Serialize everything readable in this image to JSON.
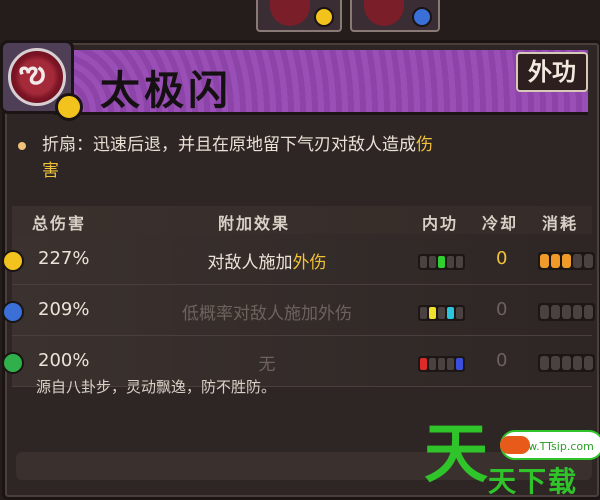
{
  "skill": {
    "name": "太极闪",
    "type_badge": "外功",
    "description_pre": "折扇：迅速后退，并且在原地留下气刃对敌人造成",
    "description_hl1": "伤",
    "description_hl2": "害"
  },
  "table": {
    "headers": {
      "total_damage": "总伤害",
      "effect": "附加效果",
      "internal": "内功",
      "cooldown": "冷却",
      "cost": "消耗"
    },
    "rows": [
      {
        "dot_color": "#f2c31c",
        "damage": "227%",
        "effect_pre": "对敌人施加",
        "effect_hl": "外伤",
        "effect_dim": false,
        "internal_pips": [
          "#4a4240",
          "#4a4240",
          "#2fd030",
          "#4a4240",
          "#4a4240"
        ],
        "cooldown": "0",
        "cooldown_dim": false,
        "cost_pips": [
          "#f09a2a",
          "#f09a2a",
          "#f09a2a",
          "#4a4240",
          "#4a4240"
        ]
      },
      {
        "dot_color": "#3a6fd8",
        "damage": "209%",
        "effect_pre": "低概率对敌人施加外伤",
        "effect_hl": "",
        "effect_dim": true,
        "internal_pips": [
          "#4a4240",
          "#f2e12a",
          "#4a4240",
          "#2ac6e0",
          "#4a4240"
        ],
        "cooldown": "0",
        "cooldown_dim": true,
        "cost_pips": [
          "#4a4240",
          "#4a4240",
          "#4a4240",
          "#4a4240",
          "#4a4240"
        ]
      },
      {
        "dot_color": "#2fb04a",
        "damage": "200%",
        "effect_pre": "无",
        "effect_hl": "",
        "effect_dim": true,
        "internal_pips": [
          "#e02a2a",
          "#4a4240",
          "#4a4240",
          "#4a4240",
          "#3a4ee0"
        ],
        "cooldown": "0",
        "cooldown_dim": true,
        "cost_pips": [
          "#4a4240",
          "#4a4240",
          "#4a4240",
          "#4a4240",
          "#4a4240"
        ]
      }
    ]
  },
  "flavor": "源自八卦步，灵动飘逸，防不胜防。",
  "watermark": {
    "big": "天",
    "small": "天下载",
    "site": "www.TTsip.com"
  },
  "colors": {
    "accent": "#f0c13a",
    "title_bar": "#9449b0"
  }
}
